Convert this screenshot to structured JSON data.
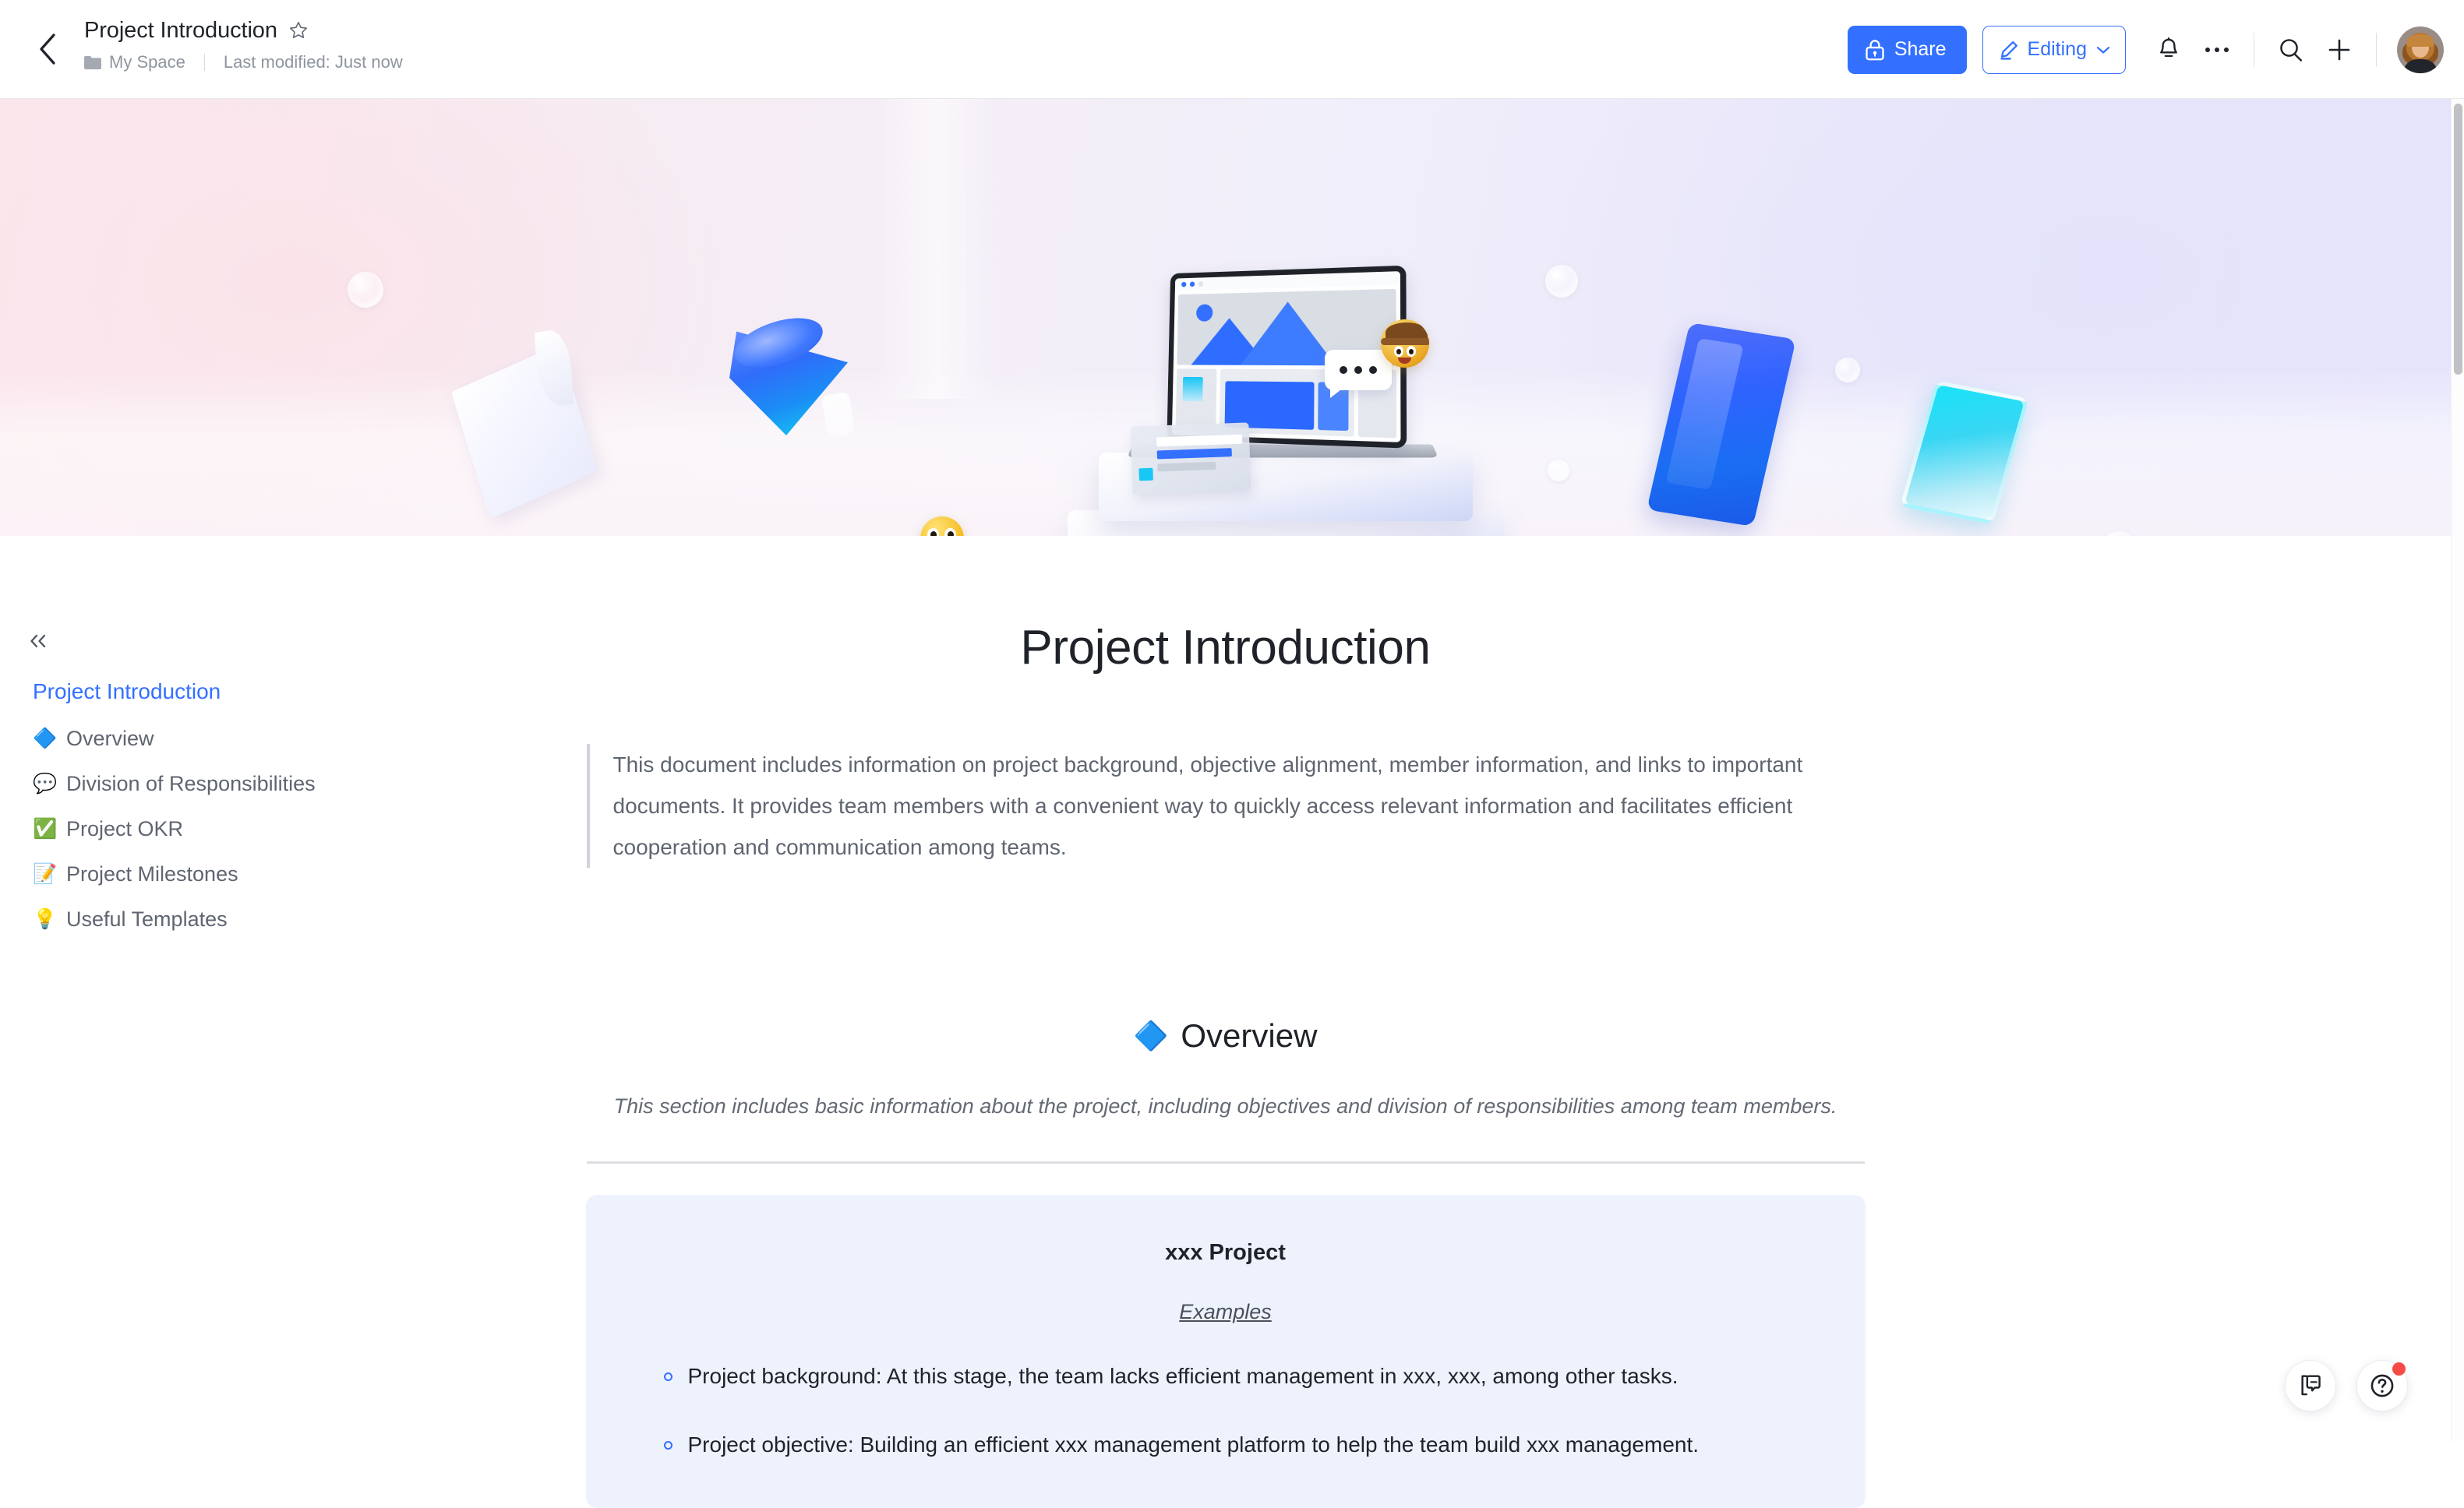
{
  "header": {
    "back_icon": "chevron-left-icon",
    "doc_title": "Project Introduction",
    "star_icon": "star-outline-icon",
    "space_icon": "folder-icon",
    "space_name": "My Space",
    "last_modified": "Last modified: Just now",
    "share_label": "Share",
    "share_icon": "lock-icon",
    "editing_label": "Editing",
    "editing_icon": "pencil-icon",
    "editing_chevron": "chevron-down-icon",
    "bell_icon": "bell-icon",
    "more_icon": "more-horizontal-icon",
    "search_icon": "search-icon",
    "add_icon": "plus-icon",
    "avatar_icon": "user-avatar"
  },
  "colors": {
    "accent": "#3370ff",
    "share_bg": "#3370ff",
    "callout_bg": "#eef2fd",
    "outline_active": "#3370ff",
    "badge_red": "#f54a45",
    "body_text": "#1f2329",
    "muted_text": "#8f959e"
  },
  "banner": {
    "name": "document-cover-image",
    "description_elements": [
      "laptop-3d",
      "chat-bubble",
      "detective-emoji",
      "star-struck-emoji",
      "blue-cone",
      "paper-sheet",
      "blue-slab",
      "cyan-slab",
      "bubbles"
    ]
  },
  "outline": {
    "collapse_icon": "double-chevron-left-icon",
    "root_label": "Project Introduction",
    "items": [
      {
        "emoji": "🔷",
        "icon_name": "blue-diamond-emoji",
        "label": "Overview"
      },
      {
        "emoji": "💬",
        "icon_name": "speech-balloon-emoji",
        "label": "Division of Responsibilities"
      },
      {
        "emoji": "✅",
        "icon_name": "check-mark-button-emoji",
        "label": "Project OKR"
      },
      {
        "emoji": "📝",
        "icon_name": "memo-emoji",
        "label": "Project Milestones"
      },
      {
        "emoji": "💡",
        "icon_name": "light-bulb-emoji",
        "label": "Useful Templates"
      }
    ]
  },
  "document": {
    "h1": "Project Introduction",
    "quote": "This document includes information on project background, objective alignment, member information, and links to important documents. It provides team members with a convenient way to quickly access relevant information and facilitates efficient cooperation and communication among teams.",
    "section": {
      "emoji": "🔷",
      "emoji_name": "blue-diamond-emoji",
      "heading": "Overview",
      "subtitle": "This section includes basic information about the project, including objectives and division of responsibilities among team members."
    },
    "callout": {
      "title": "xxx Project",
      "subtitle": "Examples",
      "bullets": [
        "Project background: At this stage, the team lacks efficient management in xxx, xxx, among other tasks.",
        "Project objective: Building an efficient xxx management platform to help the team build xxx management."
      ]
    }
  },
  "fabs": [
    {
      "icon_name": "comment-panel-icon",
      "badge": false
    },
    {
      "icon_name": "help-circle-icon",
      "badge": true
    }
  ],
  "scrollbar": {
    "name": "vertical-scrollbar"
  }
}
